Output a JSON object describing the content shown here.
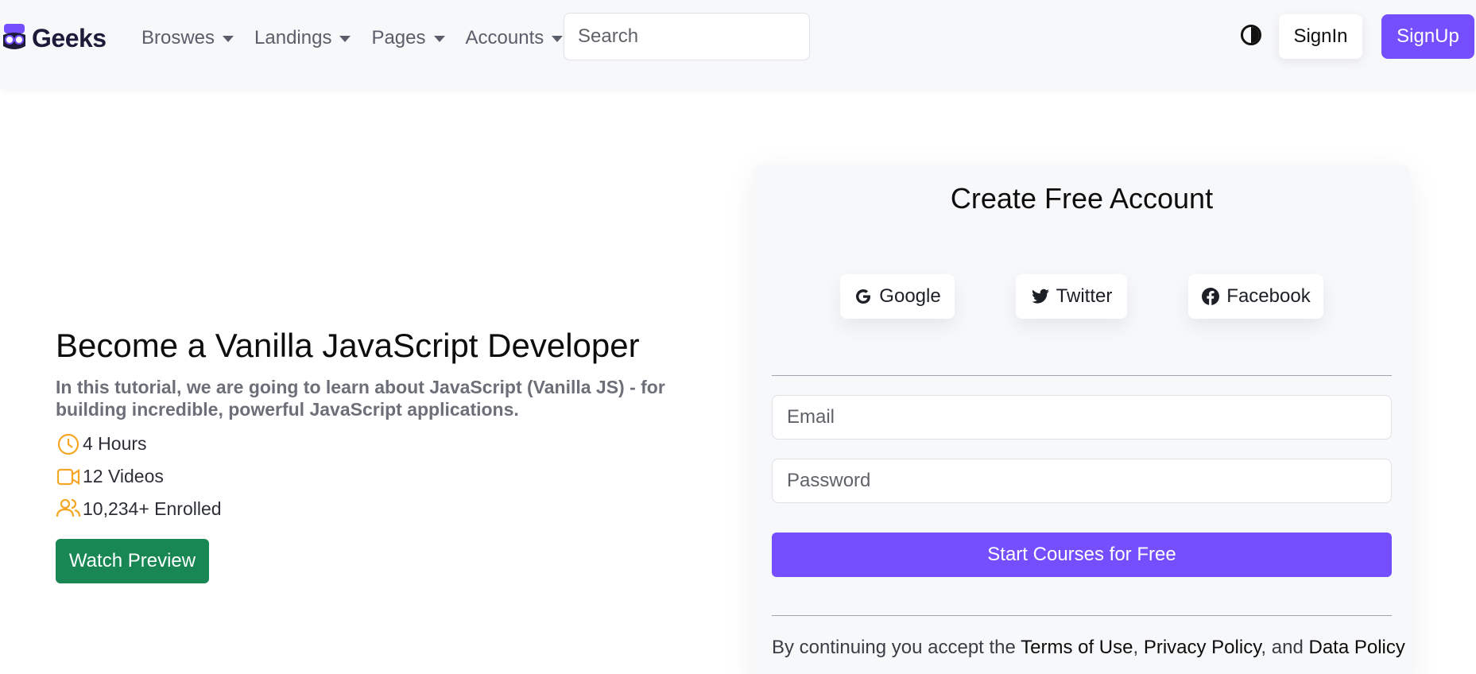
{
  "navbar": {
    "brand": "Geeks",
    "menu": [
      {
        "label": "Broswes"
      },
      {
        "label": "Landings"
      },
      {
        "label": "Pages"
      },
      {
        "label": "Accounts"
      }
    ],
    "search_placeholder": "Search",
    "signin_label": "SignIn",
    "signup_label": "SignUp"
  },
  "hero": {
    "title": "Become a Vanilla JavaScript Developer",
    "description": "In this tutorial, we are going to learn about JavaScript (Vanilla JS) - for building incredible, powerful JavaScript applications.",
    "meta": [
      {
        "icon": "clock-icon",
        "text": "4 Hours"
      },
      {
        "icon": "video-icon",
        "text": "12 Videos"
      },
      {
        "icon": "users-icon",
        "text": "10,234+ Enrolled"
      }
    ],
    "preview_label": "Watch Preview"
  },
  "signup_card": {
    "title": "Create Free Account",
    "social": [
      {
        "icon": "google-icon",
        "label": "Google"
      },
      {
        "icon": "twitter-icon",
        "label": "Twitter"
      },
      {
        "icon": "facebook-icon",
        "label": "Facebook"
      }
    ],
    "email_placeholder": "Email",
    "password_placeholder": "Password",
    "submit_label": "Start Courses for Free",
    "terms_prefix": "By continuing you accept the",
    "terms_link": "Terms of Use",
    "privacy_link": "Privacy Policy",
    "terms_and": ", and",
    "data_link": "Data Policy"
  },
  "colors": {
    "primary": "#754ffe",
    "success": "#198754",
    "meta_icon": "#f5a623",
    "navbar_bg": "#f7f8fa"
  }
}
